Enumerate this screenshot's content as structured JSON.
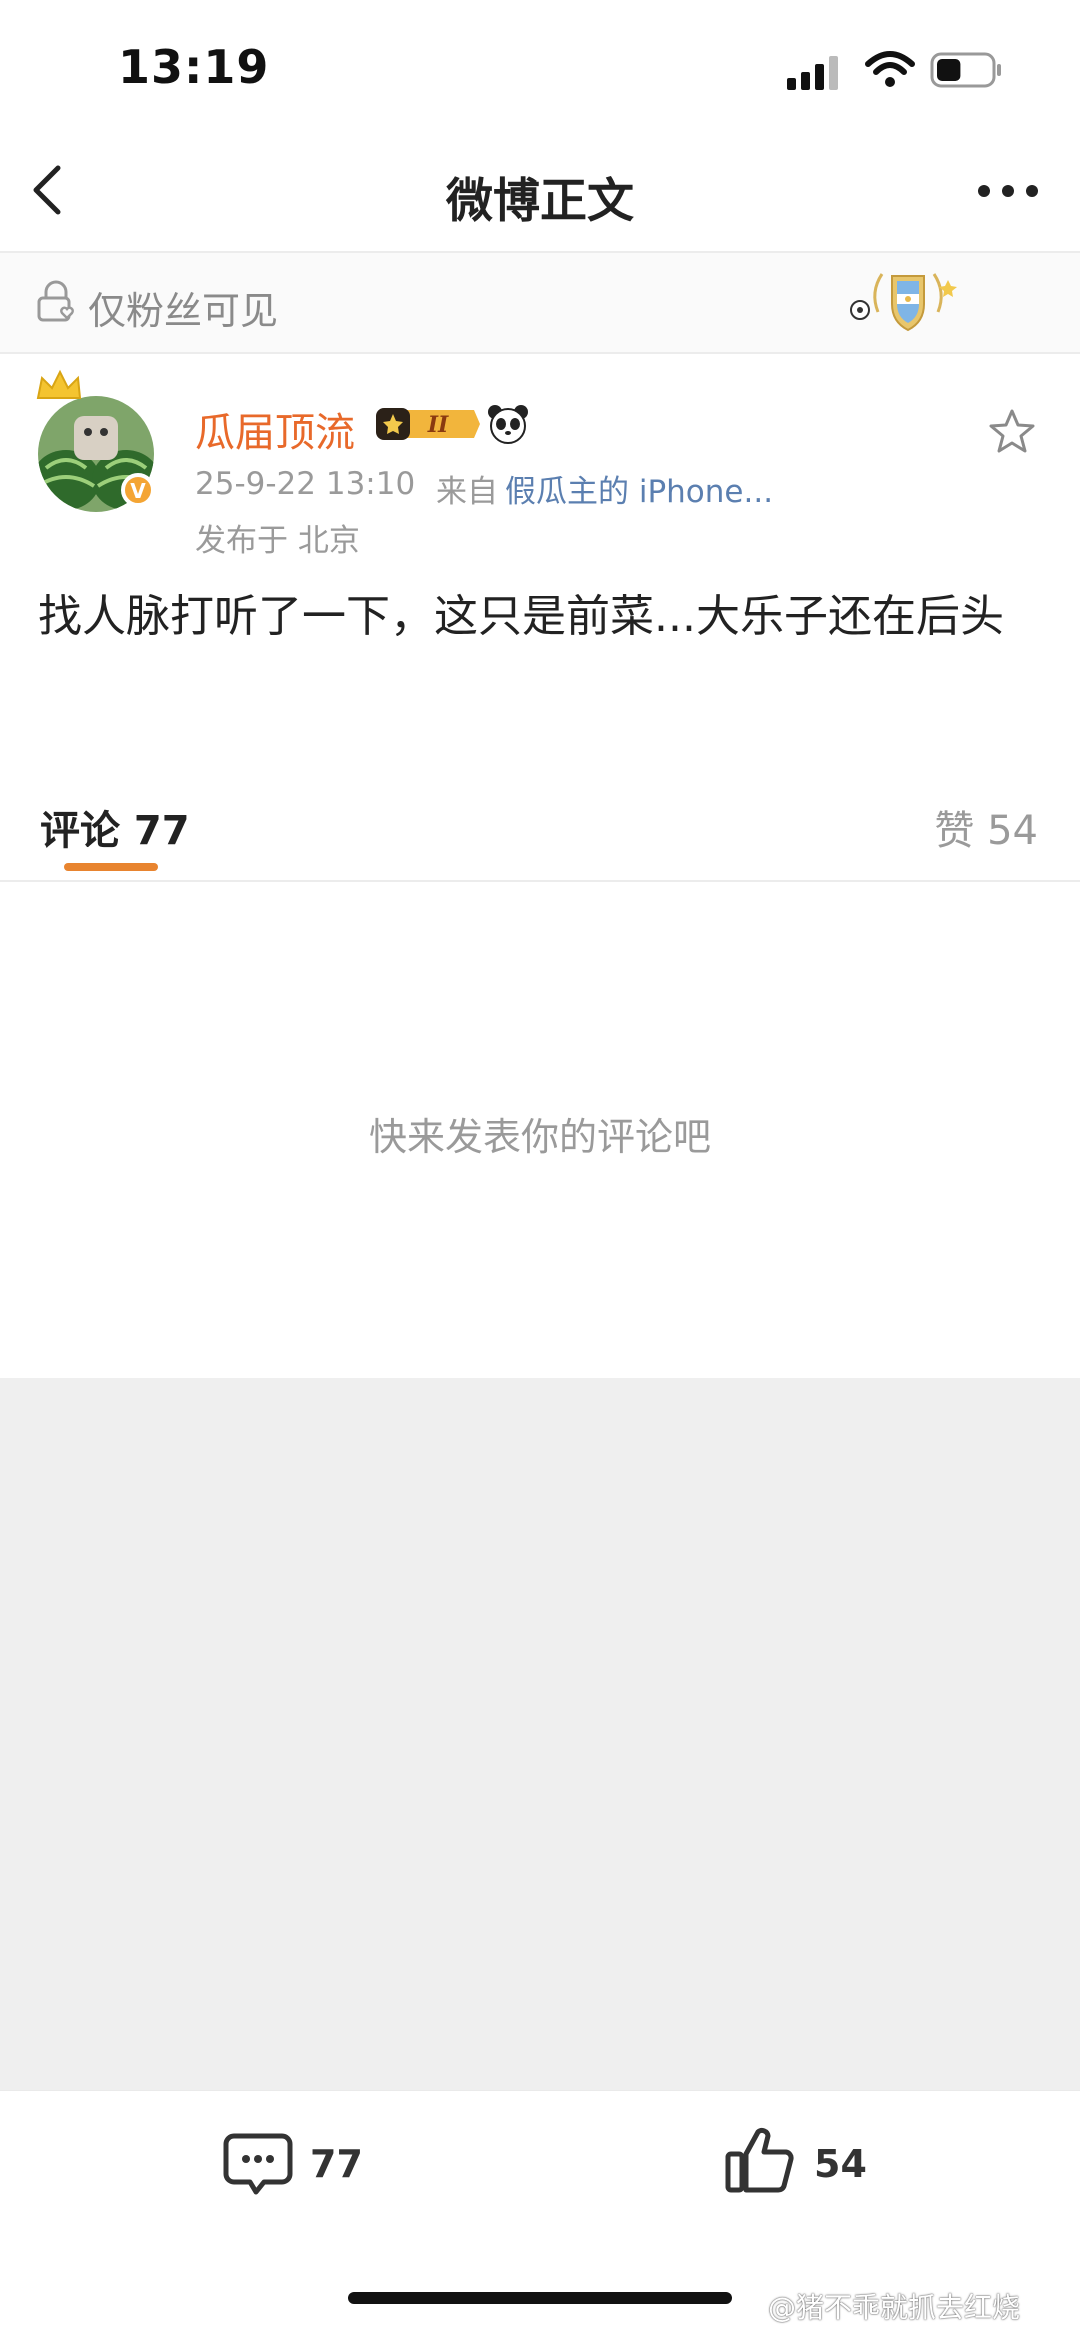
{
  "status_bar": {
    "time": "13:19",
    "battery_level": 0.45
  },
  "nav": {
    "title": "微博正文"
  },
  "visibility": {
    "label": "仅粉丝可见"
  },
  "post": {
    "username": "瓜届顶流",
    "level_badge": "II",
    "time": "25-9-22 13:10",
    "from_prefix": "来自",
    "device": "假瓜主的 iPhone...",
    "location": "发布于 北京",
    "content": "找人脉打听了一下，这只是前菜...大乐子还在后头"
  },
  "tabs": {
    "comments_label": "评论 77",
    "likes_label": "赞 54"
  },
  "empty_hint": "快来发表你的评论吧",
  "bottom_bar": {
    "comment_count": "77",
    "like_count": "54"
  },
  "watermark": "@猪不乖就抓去红烧",
  "colors": {
    "accent_orange": "#e8842f",
    "username": "#e8692a",
    "link_blue": "#5b7fb0"
  }
}
